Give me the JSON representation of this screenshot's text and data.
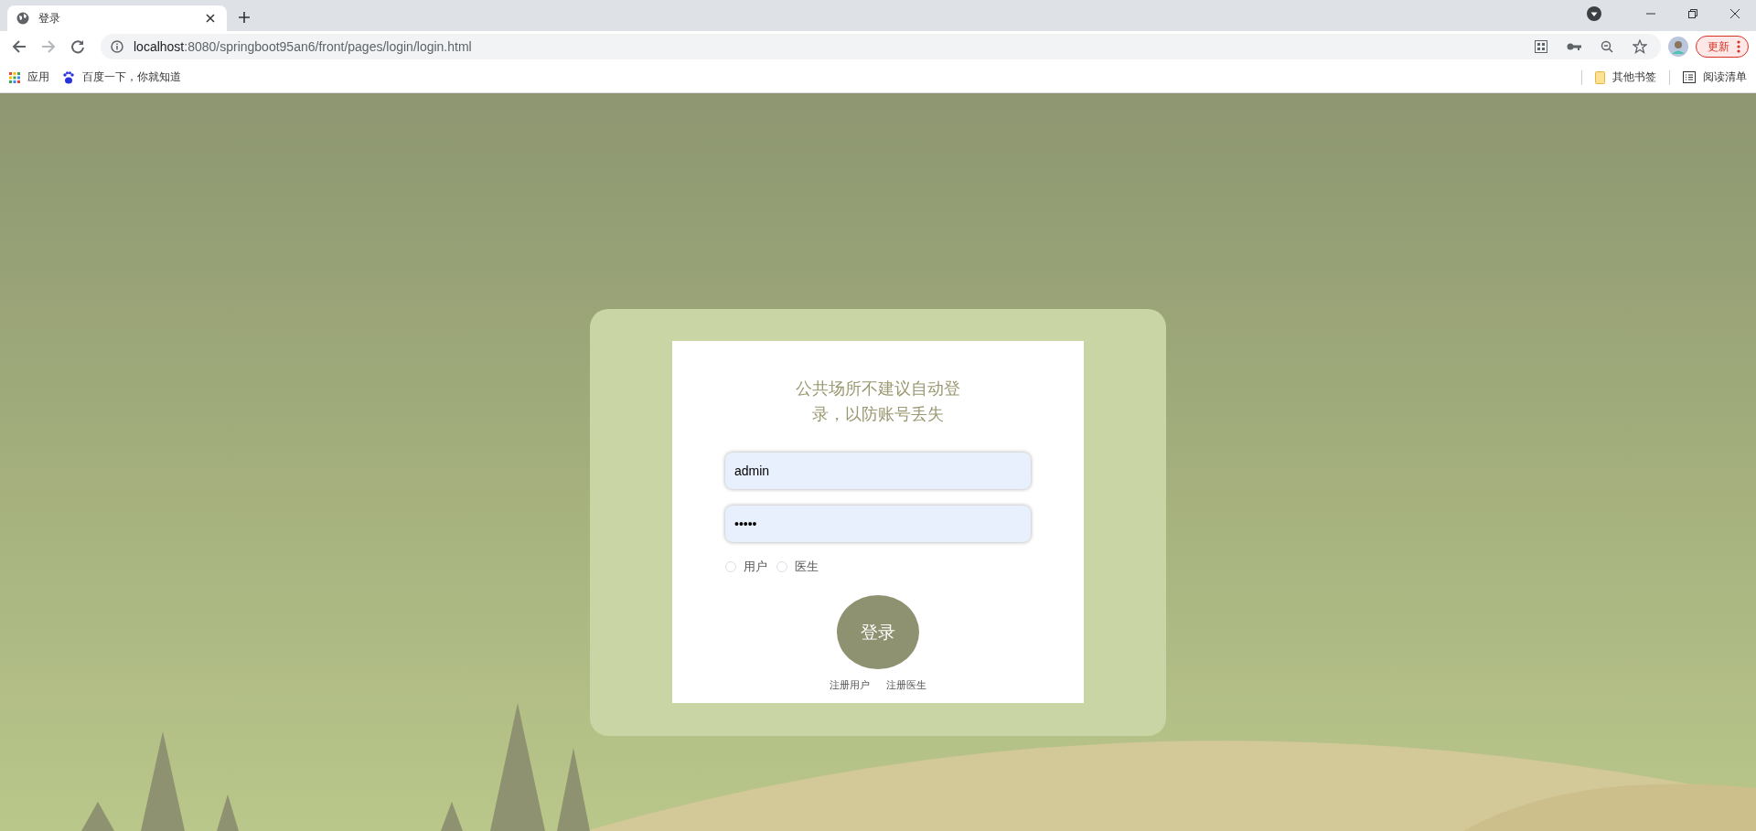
{
  "browser": {
    "tab": {
      "title": "登录",
      "selected": true
    },
    "nav": {
      "back_disabled": false,
      "forward_disabled": true
    },
    "address": {
      "host": "localhost",
      "path": ":8080/springboot95an6/front/pages/login/login.html"
    },
    "update_button": "更新",
    "bookmarks": [
      {
        "kind": "apps",
        "label": "应用"
      },
      {
        "kind": "paw",
        "label": "百度一下，你就知道"
      }
    ],
    "bookmarks_right": [
      {
        "kind": "folder",
        "label": "其他书签"
      },
      {
        "kind": "list",
        "label": "阅读清单"
      }
    ]
  },
  "login": {
    "notice": "公共场所不建议自动登录，以防账号丢失",
    "username": {
      "value": "admin"
    },
    "password": {
      "value": "•••••"
    },
    "roles": [
      {
        "label": "用户",
        "selected": false
      },
      {
        "label": "医生",
        "selected": false
      }
    ],
    "submit": "登录",
    "links": [
      "注册用户",
      "注册医生"
    ]
  }
}
